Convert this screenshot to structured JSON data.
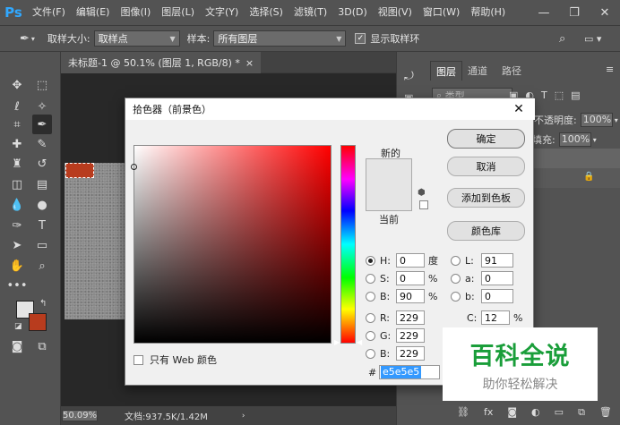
{
  "app": {
    "logo": "Ps",
    "menu": [
      "文件(F)",
      "编辑(E)",
      "图像(I)",
      "图层(L)",
      "文字(Y)",
      "选择(S)",
      "滤镜(T)",
      "3D(D)",
      "视图(V)",
      "窗口(W)",
      "帮助(H)"
    ]
  },
  "options_bar": {
    "sample_size_label": "取样大小:",
    "sample_size_value": "取样点",
    "sample_label": "样本:",
    "sample_value": "所有图层",
    "show_ring_label": "显示取样环"
  },
  "document": {
    "tab_title": "未标题-1 @ 50.1% (图层 1, RGB/8) *",
    "zoom": "50.09%",
    "doc_info": "文档:937.5K/1.42M"
  },
  "layers_panel": {
    "tabs": [
      "图层",
      "通道",
      "路径"
    ],
    "search_placeholder": "类型",
    "opacity_label": "不透明度:",
    "opacity_value": "100%",
    "fill_label": "填充:",
    "fill_value": "100%"
  },
  "color_picker": {
    "title": "拾色器（前景色）",
    "new_label": "新的",
    "current_label": "当前",
    "buttons": {
      "ok": "确定",
      "cancel": "取消",
      "add_swatch": "添加到色板",
      "libraries": "颜色库"
    },
    "only_web_label": "只有 Web 颜色",
    "fields": {
      "H": {
        "label": "H:",
        "value": "0",
        "unit": "度"
      },
      "S": {
        "label": "S:",
        "value": "0",
        "unit": "%"
      },
      "B": {
        "label": "B:",
        "value": "90",
        "unit": "%"
      },
      "R": {
        "label": "R:",
        "value": "229"
      },
      "G": {
        "label": "G:",
        "value": "229"
      },
      "Bl": {
        "label": "B:",
        "value": "229"
      },
      "L": {
        "label": "L:",
        "value": "91"
      },
      "a": {
        "label": "a:",
        "value": "0"
      },
      "b": {
        "label": "b:",
        "value": "0"
      },
      "C": {
        "label": "C:",
        "value": "12",
        "unit": "%"
      }
    },
    "hex_label": "#",
    "hex_value": "e5e5e5",
    "selected_color": "#e5e5e5"
  },
  "foreground_color": "#e5e5e5",
  "background_color": "#b83c1e",
  "watermark": {
    "title": "百科全说",
    "subtitle": "助你轻松解决"
  }
}
